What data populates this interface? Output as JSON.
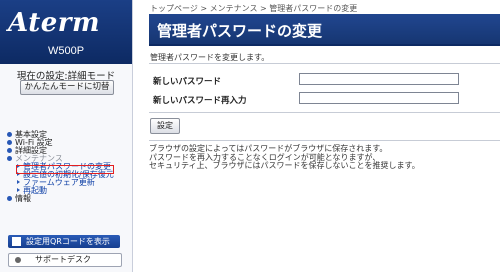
{
  "sidebar": {
    "logo": "Aterm",
    "model": "W500P",
    "mode_label": "現在の設定:詳細モード",
    "mode_button": "かんたんモードに切替",
    "menu": {
      "basic": "基本設定",
      "wifi": "Wi-Fi 設定",
      "detail": "詳細設定",
      "maintenance": "メンテナンス",
      "maintenance_items": [
        "管理者パスワードの変更",
        "設定値の初期化/保存復元",
        "ファームウェア更新",
        "再起動"
      ],
      "info": "情報"
    },
    "qr_button": "設定用QRコードを表示",
    "support_button": "サポートデスク"
  },
  "breadcrumb": {
    "top": "トップページ",
    "sep": " > ",
    "maintenance": "メンテナンス",
    "current": "管理者パスワードの変更"
  },
  "page_title": "管理者パスワードの変更",
  "description": "管理者パスワードを変更します。",
  "form": {
    "new_password_label": "新しいパスワード",
    "confirm_label": "新しいパスワード再入力"
  },
  "set_button": "設定",
  "note_lines": [
    "ブラウザの設定によってはパスワードがブラウザに保存されます。",
    "パスワードを再入力することなくログインが可能となりますが、",
    "セキュリティ上、ブラウザにはパスワードを保存しないことを推奨します。"
  ],
  "colors": {
    "header_blue": "#163672",
    "highlight_red": "#e31f1f"
  }
}
